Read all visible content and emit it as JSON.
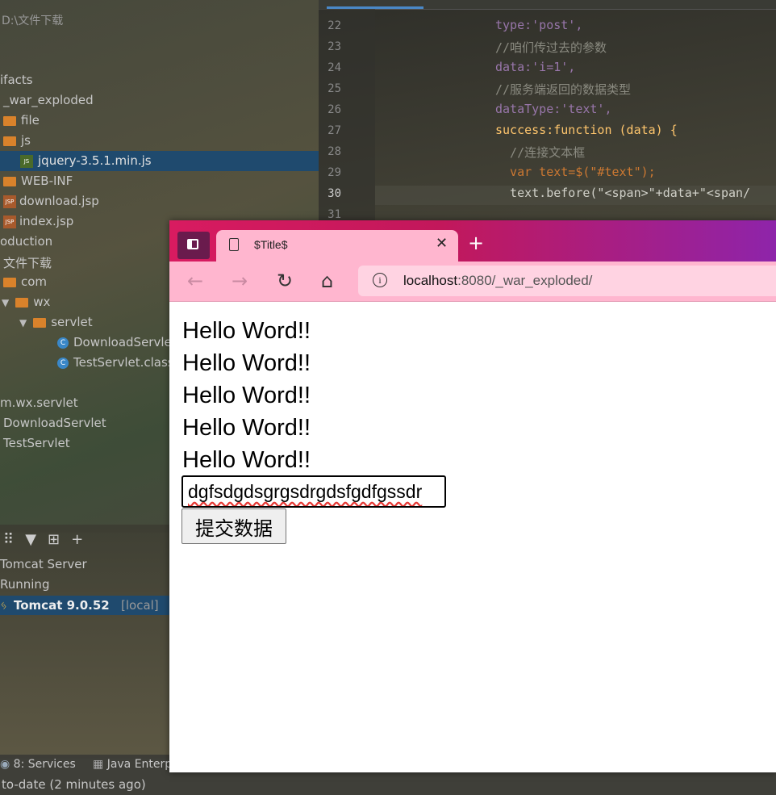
{
  "ide": {
    "project_path": "D:\\文件下载",
    "tree": [
      {
        "label": "ifacts",
        "kind": "text"
      },
      {
        "label": "_war_exploded",
        "kind": "text"
      },
      {
        "label": "file",
        "kind": "folder"
      },
      {
        "label": "js",
        "kind": "folder"
      },
      {
        "label": "jquery-3.5.1.min.js",
        "kind": "jsfile"
      },
      {
        "label": "WEB-INF",
        "kind": "folder"
      },
      {
        "label": "download.jsp",
        "kind": "jsp"
      },
      {
        "label": "index.jsp",
        "kind": "jsp"
      },
      {
        "label": "oduction",
        "kind": "text"
      },
      {
        "label": "文件下载",
        "kind": "text"
      },
      {
        "label": "com",
        "kind": "folder"
      },
      {
        "label": "wx",
        "kind": "folder-open"
      },
      {
        "label": "servlet",
        "kind": "folder-open"
      },
      {
        "label": "DownloadServle",
        "kind": "class"
      },
      {
        "label": "TestServlet.class",
        "kind": "class"
      },
      {
        "label": "m.wx.servlet",
        "kind": "text"
      },
      {
        "label": "DownloadServlet",
        "kind": "text"
      },
      {
        "label": "TestServlet",
        "kind": "text"
      }
    ],
    "code_lines": [
      {
        "num": "22",
        "text": "type:'post',"
      },
      {
        "num": "23",
        "text": "//咱们传过去的参数"
      },
      {
        "num": "24",
        "text": "data:'i=1',"
      },
      {
        "num": "25",
        "text": "//服务端返回的数据类型"
      },
      {
        "num": "26",
        "text": "dataType:'text',"
      },
      {
        "num": "27",
        "text": "success:function (data) {"
      },
      {
        "num": "28",
        "text": "  //连接文本框"
      },
      {
        "num": "29",
        "text": "  var text=$(\"#text\");"
      },
      {
        "num": "30",
        "text": "  text.before(\"<span>\"+data+\"<span/"
      },
      {
        "num": "31",
        "text": ""
      }
    ],
    "services": {
      "server": "Tomcat Server",
      "running": "Running",
      "tomcat_name": "Tomcat 9.0.52",
      "tomcat_tag": "[local]"
    },
    "status": {
      "tab_services": "8: Services",
      "tab_java": "Java Enterpr",
      "message": "to-date (2 minutes ago)"
    }
  },
  "browser": {
    "tab_title": "$Title$",
    "url_host": "localhost",
    "url_rest": ":8080/_war_exploded/",
    "hello_lines": [
      "Hello Word!!",
      "Hello Word!!",
      "Hello Word!!",
      "Hello Word!!",
      "Hello Word!!"
    ],
    "input_value": "dgfsdgdsgrgsdrgdsfgdfgssdr",
    "submit_label": "提交数据"
  }
}
